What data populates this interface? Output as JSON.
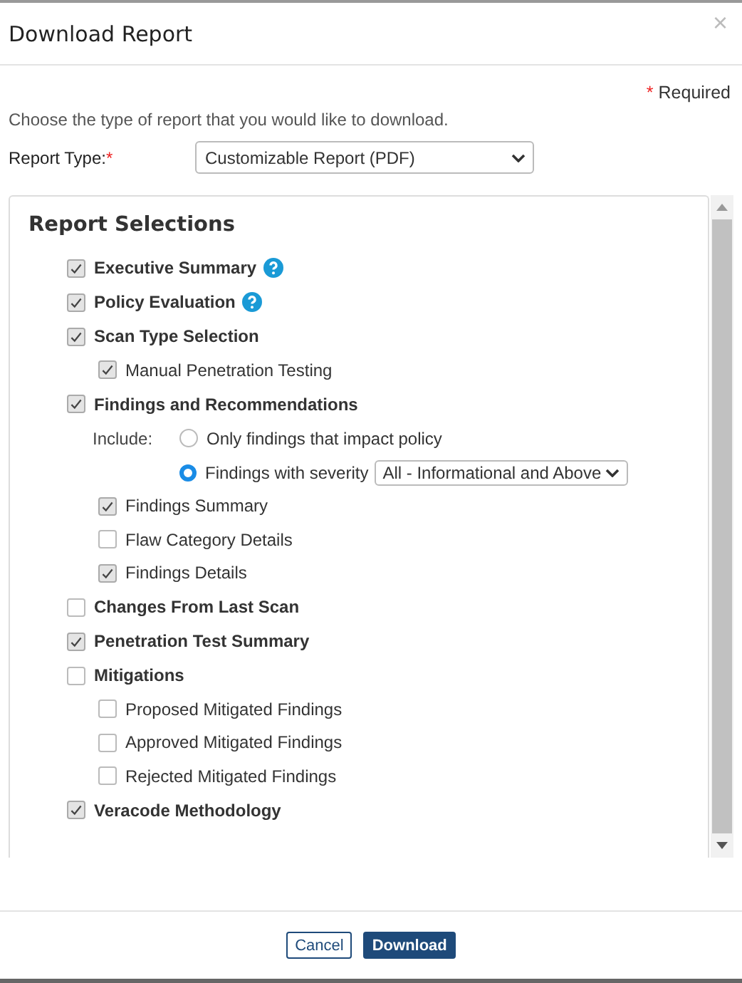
{
  "dialog": {
    "title": "Download Report",
    "close": "×"
  },
  "required_note": {
    "mark": "*",
    "text": "Required"
  },
  "intro": "Choose the type of report that you would like to download.",
  "report_type": {
    "label": "Report Type:",
    "mark": "*",
    "value": "Customizable Report (PDF)"
  },
  "selections": {
    "title": "Report Selections",
    "items": [
      {
        "label": "Executive Summary",
        "checked": true,
        "help": true
      },
      {
        "label": "Policy Evaluation",
        "checked": true,
        "help": true
      },
      {
        "label": "Scan Type Selection",
        "checked": true,
        "help": false,
        "children": [
          {
            "label": "Manual Penetration Testing",
            "checked": true
          }
        ]
      },
      {
        "label": "Findings and Recommendations",
        "checked": true,
        "help": false,
        "include": {
          "label": "Include:",
          "options": [
            {
              "label": "Only findings that impact policy",
              "selected": false
            },
            {
              "label": "Findings with severity",
              "selected": true,
              "select": "All - Informational and Above"
            }
          ]
        },
        "children": [
          {
            "label": "Findings Summary",
            "checked": true
          },
          {
            "label": "Flaw Category Details",
            "checked": false
          },
          {
            "label": "Findings Details",
            "checked": true
          }
        ]
      },
      {
        "label": "Changes From Last Scan",
        "checked": false,
        "help": false
      },
      {
        "label": "Penetration Test Summary",
        "checked": true,
        "help": false
      },
      {
        "label": "Mitigations",
        "checked": false,
        "help": false,
        "children": [
          {
            "label": "Proposed Mitigated Findings",
            "checked": false
          },
          {
            "label": "Approved Mitigated Findings",
            "checked": false
          },
          {
            "label": "Rejected Mitigated Findings",
            "checked": false
          }
        ]
      },
      {
        "label": "Veracode Methodology",
        "checked": true,
        "help": false
      }
    ]
  },
  "buttons": {
    "cancel": "Cancel",
    "download": "Download"
  }
}
